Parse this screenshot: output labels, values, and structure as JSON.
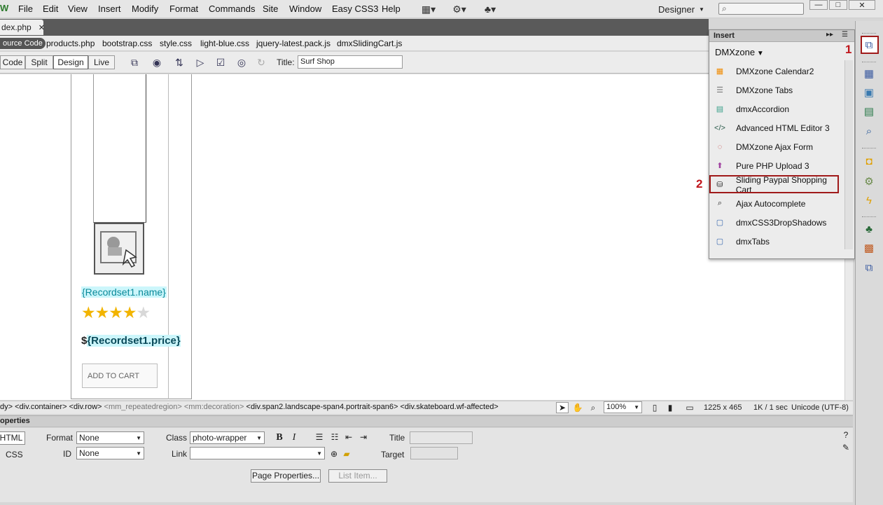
{
  "app": {
    "logo": "W",
    "menus": [
      "File",
      "Edit",
      "View",
      "Insert",
      "Modify",
      "Format",
      "Commands",
      "Site",
      "Window",
      "Easy CSS3",
      "Help"
    ],
    "workspace": "Designer",
    "window_buttons": [
      "—",
      "□",
      "✕"
    ]
  },
  "document": {
    "tab_label": "dex.php",
    "tab_close": "✕",
    "source_code": "ource Code",
    "related_files": [
      "products.php",
      "bootstrap.css",
      "style.css",
      "light-blue.css",
      "jquery-latest.pack.js",
      "dmxSlidingCart.js"
    ],
    "view_buttons": [
      "Code",
      "Split",
      "Design",
      "Live"
    ],
    "active_view": "Design",
    "title_label": "Title:",
    "title_value": "Surf Shop"
  },
  "canvas": {
    "record_name": "{Recordset1.name}",
    "rating_filled": 4,
    "rating_total": 5,
    "price_prefix": "$",
    "price_value": "{Recordset1.price}",
    "add_to_cart": "ADD TO CART"
  },
  "status": {
    "tag_path_parts": [
      {
        "text": "dy>",
        "muted": false
      },
      {
        "text": "<div.container>",
        "muted": false
      },
      {
        "text": "<div.row>",
        "muted": false
      },
      {
        "text": "<mm_repeatedregion>",
        "muted": true
      },
      {
        "text": "<mm:decoration>",
        "muted": true
      },
      {
        "text": "<div.span2.landscape-span4.portrait-span6>",
        "muted": false
      },
      {
        "text": "<div.skateboard.wf-affected>",
        "muted": false
      }
    ],
    "zoom": "100%",
    "dimensions": "1225 x 465",
    "size_time": "1K / 1 sec",
    "encoding": "Unicode (UTF-8)"
  },
  "properties": {
    "title": "operties",
    "html_btn": "HTML",
    "css_btn": "CSS",
    "format_label": "Format",
    "format_value": "None",
    "id_label": "ID",
    "id_value": "None",
    "class_label": "Class",
    "class_value": "photo-wrapper",
    "link_label": "Link",
    "link_value": "",
    "title_label": "Title",
    "target_label": "Target",
    "page_properties": "Page Properties...",
    "list_item": "List Item..."
  },
  "insert_panel": {
    "title": "Insert",
    "category": "DMXzone",
    "items": [
      {
        "label": "DMXzone Calendar2",
        "icon": "calendar-icon",
        "color": "#f08a00"
      },
      {
        "label": "DMXzone Tabs",
        "icon": "tabs-icon",
        "color": "#7a7a7a"
      },
      {
        "label": "dmxAccordion",
        "icon": "accordion-icon",
        "color": "#3aa08a"
      },
      {
        "label": "Advanced HTML Editor 3",
        "icon": "html-editor-icon",
        "color": "#2a5a4a"
      },
      {
        "label": "DMXzone Ajax Form",
        "icon": "ajax-form-icon",
        "color": "#c03a3a"
      },
      {
        "label": "Pure PHP Upload 3",
        "icon": "upload-icon",
        "color": "#a040a0"
      },
      {
        "label": "Sliding Paypal Shopping Cart",
        "icon": "basket-icon",
        "color": "#222222"
      },
      {
        "label": "Ajax Autocomplete",
        "icon": "magnifier-icon",
        "color": "#222222"
      },
      {
        "label": "dmxCSS3DropShadows",
        "icon": "document-icon",
        "color": "#3a6ab0"
      },
      {
        "label": "dmxTabs",
        "icon": "document-icon",
        "color": "#3a6ab0"
      }
    ],
    "callout_1": "1",
    "callout_2": "2"
  }
}
